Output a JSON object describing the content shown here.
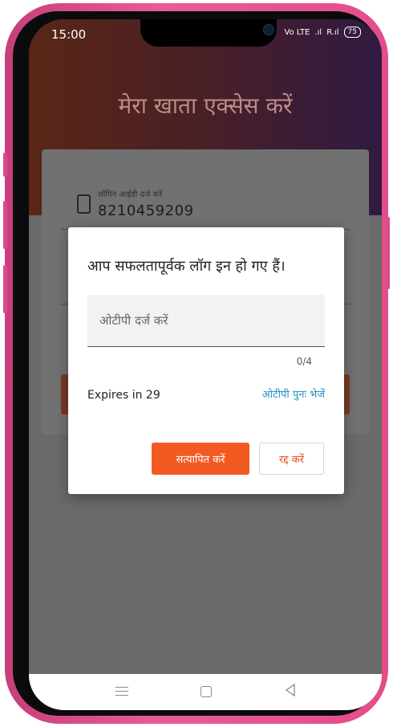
{
  "status_bar": {
    "time": "15:00",
    "network_label": "Vo LTE",
    "signal_1": ".ıl",
    "signal_2": "R.ıl",
    "battery": "75"
  },
  "page": {
    "title": "मेरा खाता एक्सेस करें",
    "login_id_label": "लॉगिन आईडी दर्ज करें",
    "login_id_value": "8210459209",
    "help_mark": "?"
  },
  "dialog": {
    "title": "आप सफलतापूर्वक लॉग इन हो गए हैं।",
    "otp_placeholder": "ओटीपी दर्ज करें",
    "otp_value": "",
    "counter": "0/4",
    "expires_text": "Expires in 29",
    "resend_label": "ओटीपी पुनः भेजें",
    "verify_label": "सत्यापित करें",
    "cancel_label": "रद्द करें"
  },
  "nav": {
    "menu_icon": "menu-icon",
    "home_icon": "home-icon",
    "back_icon": "back-icon"
  },
  "colors": {
    "accent": "#f35a22",
    "link": "#2a8fcb",
    "frame": "#e34d8a"
  }
}
